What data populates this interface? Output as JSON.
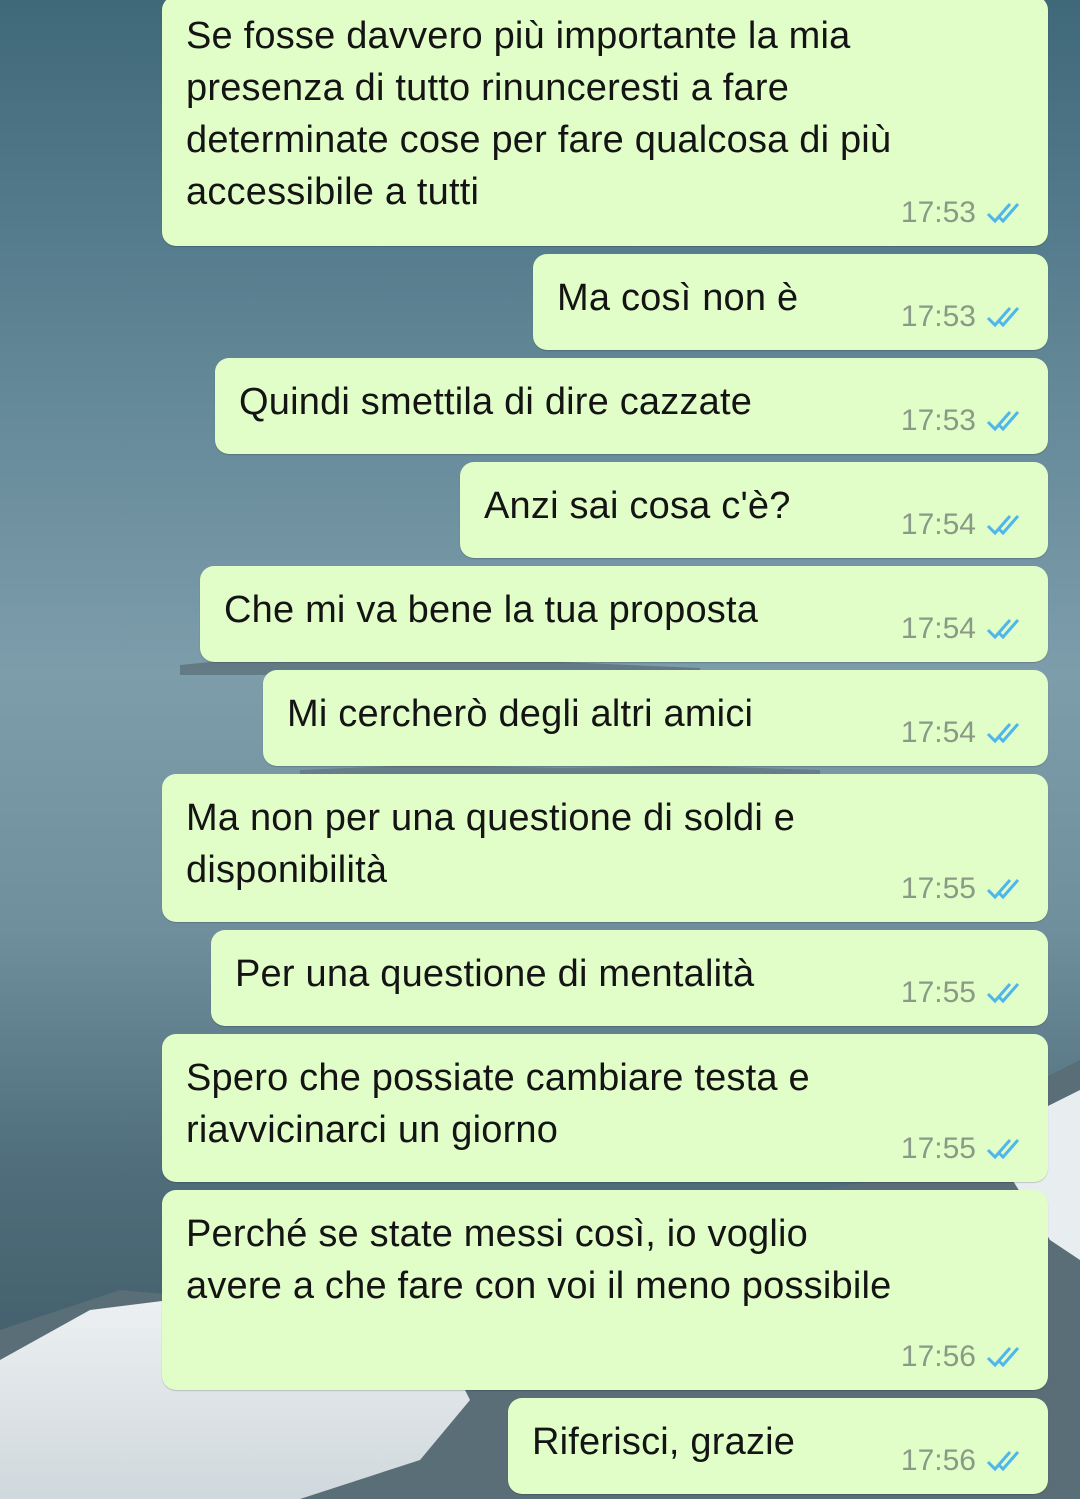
{
  "chat": {
    "messages": [
      {
        "text": "Se fosse davvero più importante la mia\npresenza di tutto rinunceresti a fare\ndeterminate cose per fare qualcosa di più\naccessibile a tutti",
        "time": "17:53",
        "status": "read-double-check-icon"
      },
      {
        "text": "Ma così non è",
        "time": "17:53",
        "status": "read-double-check-icon"
      },
      {
        "text": "Quindi smettila di dire cazzate",
        "time": "17:53",
        "status": "read-double-check-icon"
      },
      {
        "text": "Anzi sai cosa c'è?",
        "time": "17:54",
        "status": "read-double-check-icon"
      },
      {
        "text": "Che mi va bene la tua proposta",
        "time": "17:54",
        "status": "read-double-check-icon"
      },
      {
        "text": "Mi cercherò degli altri amici",
        "time": "17:54",
        "status": "read-double-check-icon"
      },
      {
        "text": "Ma non per una questione di soldi e\ndisponibilità",
        "time": "17:55",
        "status": "read-double-check-icon"
      },
      {
        "text": "Per una questione di mentalità",
        "time": "17:55",
        "status": "read-double-check-icon"
      },
      {
        "text": "Spero che possiate cambiare testa e\nriavvicinarci un giorno",
        "time": "17:55",
        "status": "read-double-check-icon"
      },
      {
        "text": "Perché se state messi così, io voglio\navere a che fare con voi il meno possibile",
        "time": "17:56",
        "status": "read-double-check-icon"
      },
      {
        "text": "Riferisci, grazie",
        "time": "17:56",
        "status": "read-double-check-icon"
      }
    ]
  },
  "colors": {
    "bubble": "#e1fdc8",
    "read_ticks": "#4fb6ec",
    "time_text": "#8a9a86"
  }
}
